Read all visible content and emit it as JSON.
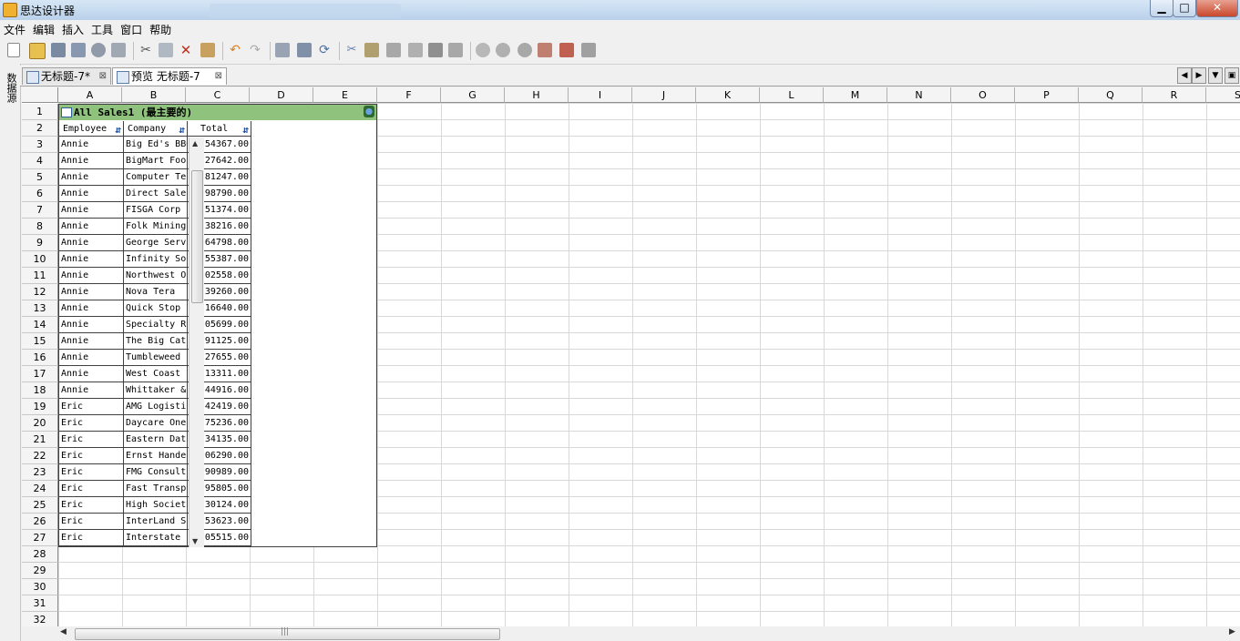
{
  "window": {
    "title": "思达设计器",
    "min_glyph": "▁",
    "max_glyph": "□",
    "close_glyph": "✕"
  },
  "menu": [
    "文件",
    "编辑",
    "插入",
    "工具",
    "窗口",
    "帮助"
  ],
  "side_panel": {
    "label": "数据源"
  },
  "tabs": [
    {
      "label": "无标题-7*",
      "close": "⊠"
    },
    {
      "label": "预览 无标题-7",
      "close": "⊠"
    }
  ],
  "nav": {
    "prev": "◀",
    "next": "▶",
    "menu": "▼",
    "restore": "▣"
  },
  "columns": [
    "A",
    "B",
    "C",
    "D",
    "E",
    "F",
    "G",
    "H",
    "I",
    "J",
    "K",
    "L",
    "M",
    "N",
    "O",
    "P",
    "Q",
    "R",
    "S"
  ],
  "rows": [
    "1",
    "2",
    "3",
    "4",
    "5",
    "6",
    "7",
    "8",
    "9",
    "10",
    "11",
    "12",
    "13",
    "14",
    "15",
    "16",
    "17",
    "18",
    "19",
    "20",
    "21",
    "22",
    "23",
    "24",
    "25",
    "26",
    "27",
    "28",
    "29",
    "30",
    "31",
    "32"
  ],
  "report": {
    "title": "All Sales1 (最主要的)",
    "headers": [
      "Employee",
      "Company",
      "Total"
    ],
    "sort_glyph": "⇵",
    "scroll_up": "▲",
    "scroll_down": "▼",
    "rows": [
      [
        "Annie",
        "Big Ed's BBQ",
        "54367.00"
      ],
      [
        "Annie",
        "BigMart Foo",
        "27642.00"
      ],
      [
        "Annie",
        "Computer Te",
        "81247.00"
      ],
      [
        "Annie",
        "Direct Sale",
        "98790.00"
      ],
      [
        "Annie",
        "FISGA Corp",
        "51374.00"
      ],
      [
        "Annie",
        "Folk Mining",
        "38216.00"
      ],
      [
        "Annie",
        "George Serv",
        "64798.00"
      ],
      [
        "Annie",
        "Infinity So",
        "55387.00"
      ],
      [
        "Annie",
        "Northwest O",
        "02558.00"
      ],
      [
        "Annie",
        "Nova Tera",
        "39260.00"
      ],
      [
        "Annie",
        "Quick Stop",
        "16640.00"
      ],
      [
        "Annie",
        "Specialty R",
        "05699.00"
      ],
      [
        "Annie",
        "The Big Cat",
        "91125.00"
      ],
      [
        "Annie",
        "Tumbleweed",
        "27655.00"
      ],
      [
        "Annie",
        "West Coast",
        "13311.00"
      ],
      [
        "Annie",
        "Whittaker &",
        "44916.00"
      ],
      [
        "Eric",
        "AMG Logisti",
        "42419.00"
      ],
      [
        "Eric",
        "Daycare One",
        "75236.00"
      ],
      [
        "Eric",
        "Eastern Dat",
        "34135.00"
      ],
      [
        "Eric",
        "Ernst Hande",
        "06290.00"
      ],
      [
        "Eric",
        "FMG Consult",
        "90989.00"
      ],
      [
        "Eric",
        "Fast Transp",
        "95805.00"
      ],
      [
        "Eric",
        "High Society",
        "30124.00"
      ],
      [
        "Eric",
        "InterLand S",
        "53623.00"
      ],
      [
        "Eric",
        "Interstate",
        "05515.00"
      ]
    ]
  },
  "hscroll": {
    "left": "◀",
    "right": "▶",
    "grip": "|||"
  },
  "colors": {
    "title_bar": "#8fc27c",
    "grid_line": "#d8d8d8",
    "header_bg": "#f4f4f4"
  }
}
